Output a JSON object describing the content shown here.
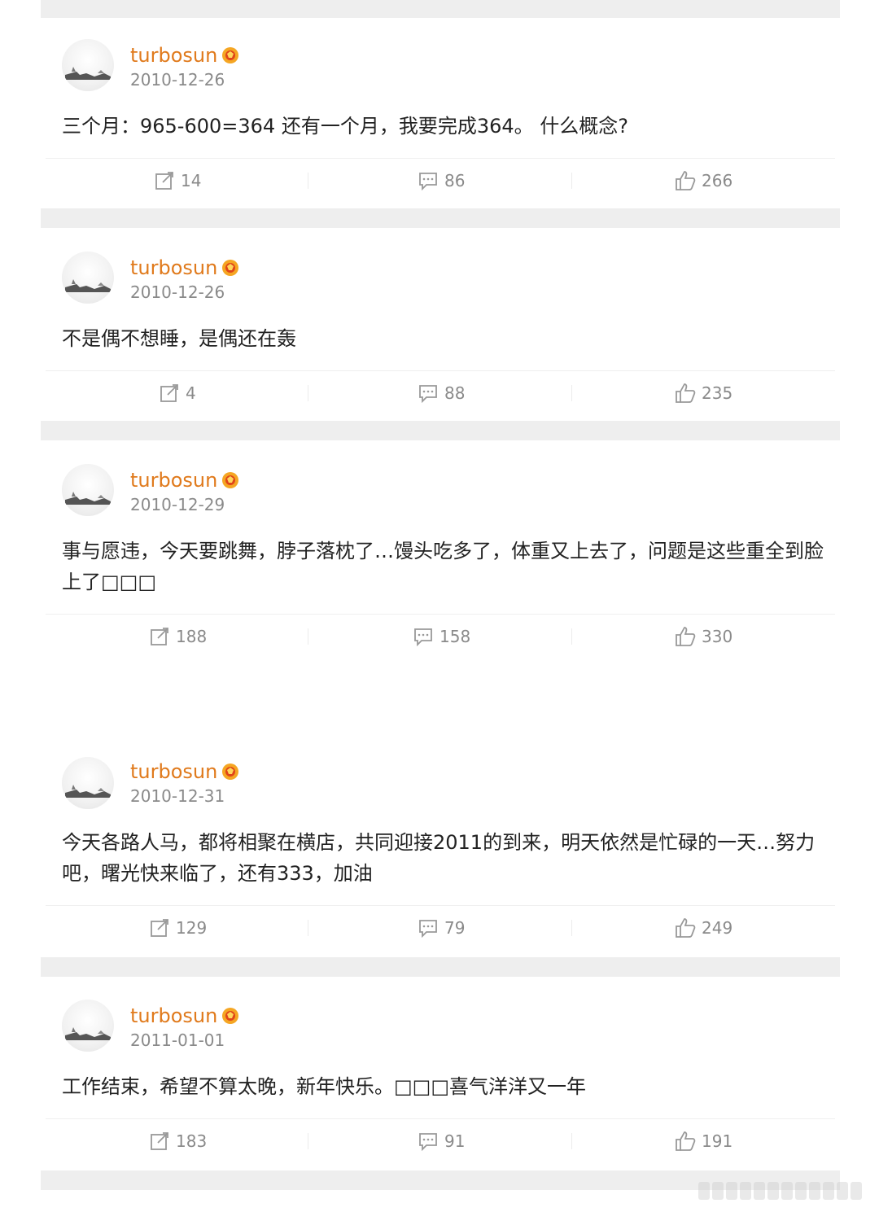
{
  "posts": [
    {
      "username": "turbosun",
      "date": "2010-12-26",
      "text": "三个月：965-600=364 还有一个月，我要完成364。 什么概念?",
      "reposts": "14",
      "comments": "86",
      "likes": "266"
    },
    {
      "username": "turbosun",
      "date": "2010-12-26",
      "text": "不是偶不想睡，是偶还在轰",
      "reposts": "4",
      "comments": "88",
      "likes": "235"
    },
    {
      "username": "turbosun",
      "date": "2010-12-29",
      "text": "事与愿违，今天要跳舞，脖子落枕了…馒头吃多了，体重又上去了，问题是这些重全到脸上了□□□",
      "reposts": "188",
      "comments": "158",
      "likes": "330"
    },
    {
      "username": "turbosun",
      "date": "2010-12-31",
      "text": "今天各路人马，都将相聚在横店，共同迎接2011的到来，明天依然是忙碌的一天…努力吧，曙光快来临了，还有333，加油",
      "reposts": "129",
      "comments": "79",
      "likes": "249"
    },
    {
      "username": "turbosun",
      "date": "2011-01-01",
      "text": "工作结束，希望不算太晚，新年快乐。□□□喜气洋洋又一年",
      "reposts": "183",
      "comments": "91",
      "likes": "191"
    }
  ],
  "icons": {
    "repost": "repost-icon",
    "comment": "comment-icon",
    "like": "like-icon",
    "vip": "vip-badge-icon"
  },
  "colors": {
    "username": "#e07a1c",
    "meta": "#8a8a8a",
    "text": "#222222",
    "divider": "#eeeeee"
  }
}
